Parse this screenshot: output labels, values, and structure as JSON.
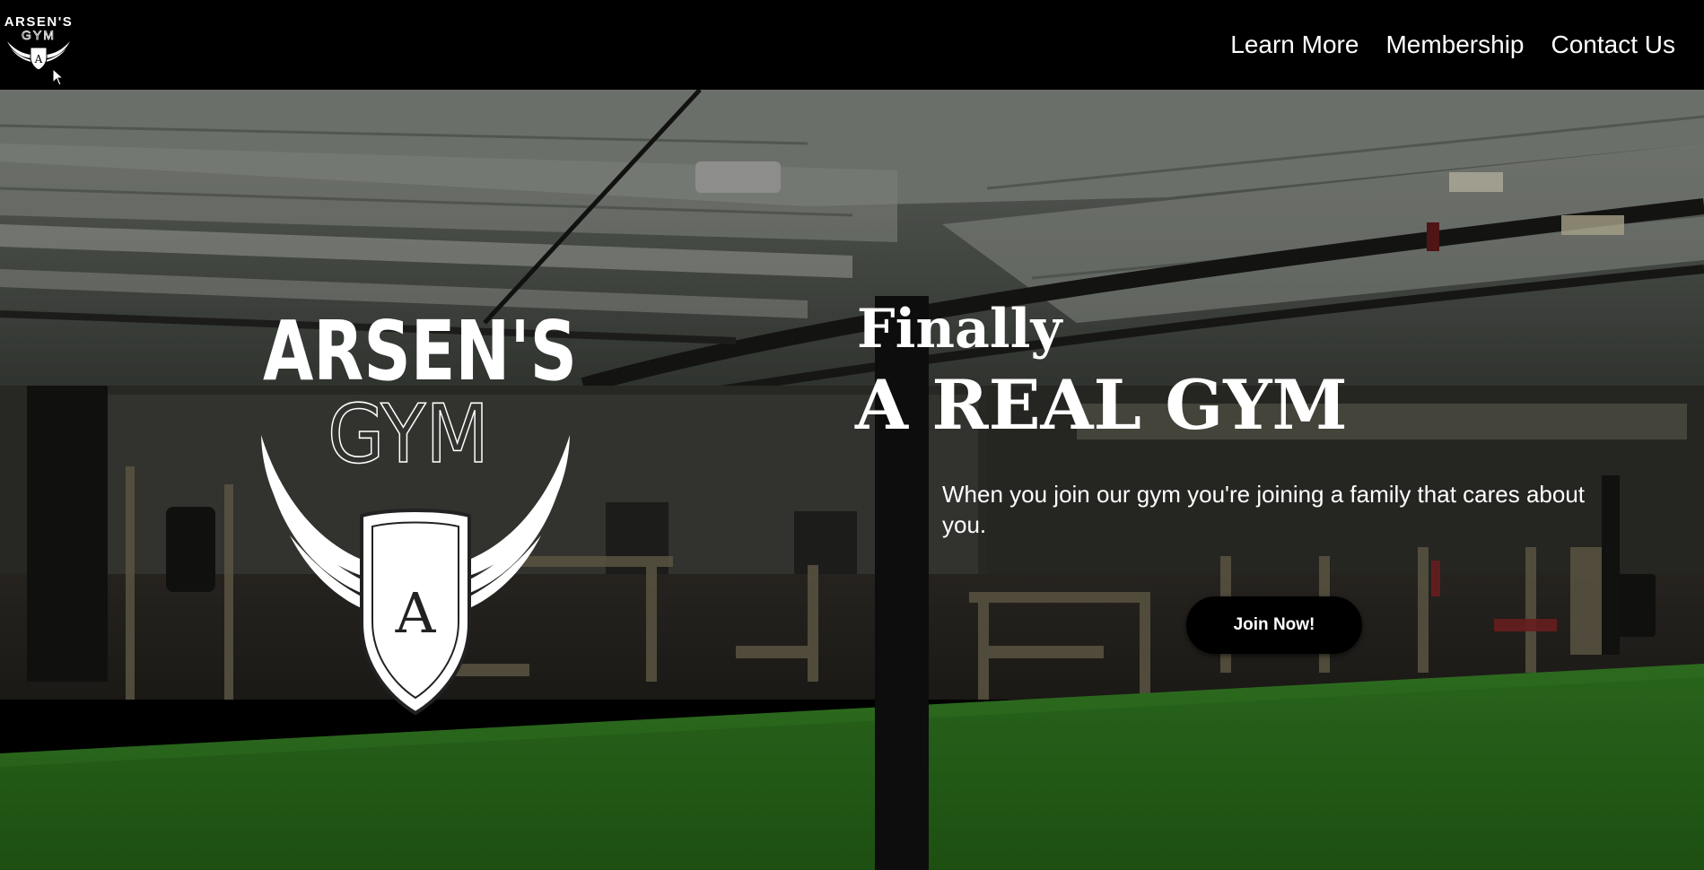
{
  "header": {
    "logo": {
      "line1": "ARSEN'S",
      "line2": "GYM",
      "crest_letter": "A"
    },
    "nav": [
      {
        "label": "Learn More"
      },
      {
        "label": "Membership"
      },
      {
        "label": "Contact Us"
      }
    ]
  },
  "hero": {
    "logo": {
      "line1": "ARSEN'S",
      "line2": "GYM",
      "crest_letter": "A"
    },
    "headline_small": "Finally",
    "headline_large": "A REAL GYM",
    "tagline": "When you join our gym you're joining a family that cares about you.",
    "cta_label": "Join Now!"
  },
  "colors": {
    "background": "#000000",
    "text": "#ffffff",
    "turf_green": "#3fae2a",
    "button_bg": "#000000"
  },
  "icons": [
    "gym-logo",
    "wings-crest-icon",
    "mouse-cursor-icon"
  ]
}
